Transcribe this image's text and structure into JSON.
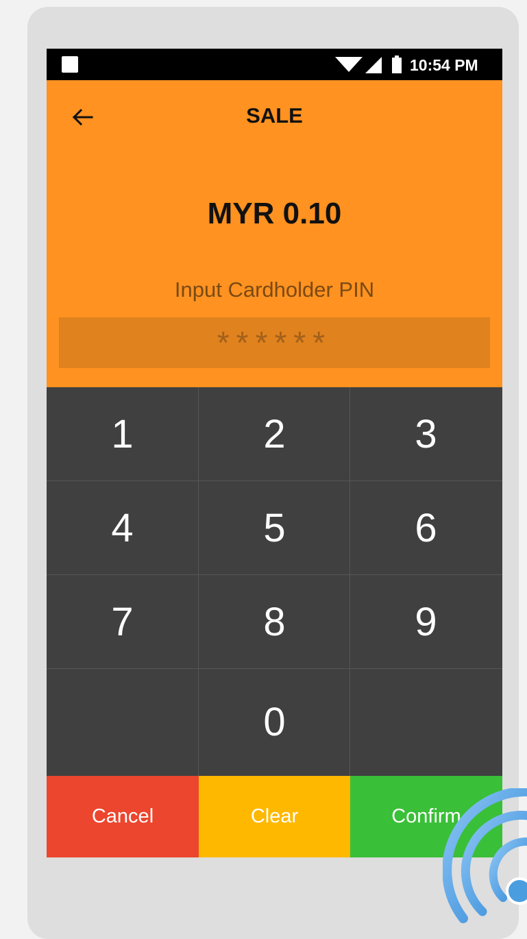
{
  "status_bar": {
    "time": "10:54 PM",
    "icons": [
      "notification-square-icon",
      "wifi-icon",
      "signal-icon",
      "battery-icon"
    ]
  },
  "header": {
    "back_icon": "arrow-left-icon",
    "title": "SALE"
  },
  "transaction": {
    "amount": "MYR 0.10",
    "prompt": "Input Cardholder PIN",
    "pin_mask": "******"
  },
  "keypad": {
    "keys": [
      "1",
      "2",
      "3",
      "4",
      "5",
      "6",
      "7",
      "8",
      "9",
      "",
      "0",
      ""
    ]
  },
  "actions": {
    "cancel": "Cancel",
    "clear": "Clear",
    "confirm": "Confirm"
  },
  "colors": {
    "brand_orange": "#ff9220",
    "keypad_dark": "#404040",
    "cancel_red": "#ec462e",
    "clear_amber": "#ffb800",
    "confirm_green": "#3abf38",
    "nfc_blue": "#4a9ee0"
  },
  "overlay": {
    "icon": "nfc-contactless-icon"
  }
}
